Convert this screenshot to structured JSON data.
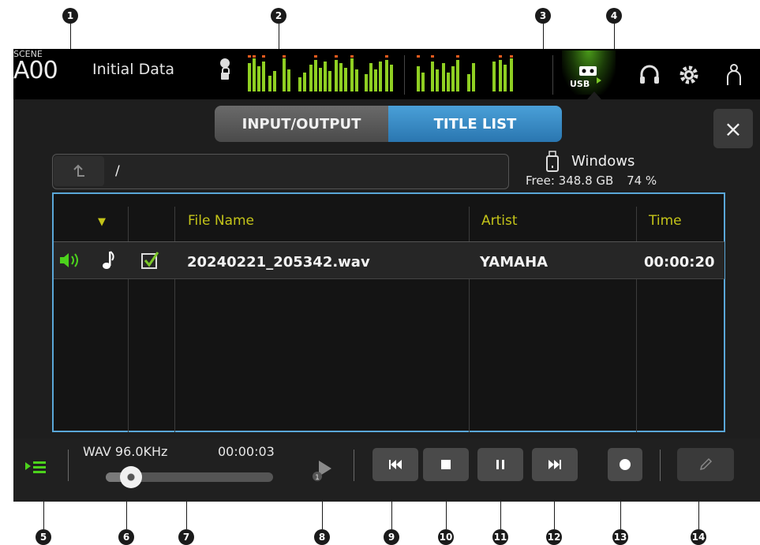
{
  "callouts": [
    "1",
    "2",
    "3",
    "4",
    "5",
    "6",
    "7",
    "8",
    "9",
    "10",
    "11",
    "12",
    "13",
    "14"
  ],
  "header": {
    "scene_label": "SCENE",
    "scene_number": "A00",
    "scene_name": "Initial Data",
    "usb_label": "USB"
  },
  "tabs": {
    "input_output": "INPUT/OUTPUT",
    "title_list": "TITLE LIST"
  },
  "close_label": "×",
  "navigator": {
    "path": "/"
  },
  "drive": {
    "name": "Windows",
    "free_label": "Free:",
    "free_value": "348.8 GB",
    "percent": "74 %"
  },
  "table": {
    "columns": {
      "sort": "▼",
      "file_name": "File Name",
      "artist": "Artist",
      "time": "Time"
    },
    "rows": [
      {
        "file_name": "20240221_205342.wav",
        "artist": "YAMAHA",
        "time": "00:00:20"
      }
    ]
  },
  "bottom": {
    "format": "WAV 96.0KHz",
    "position_time": "00:00:03",
    "progress": 0.15
  },
  "colors": {
    "accent": "#2a76b0",
    "meter_green": "#7bc628",
    "header_yellow": "#c4c419",
    "highlight_blue": "#5aa7d8"
  }
}
